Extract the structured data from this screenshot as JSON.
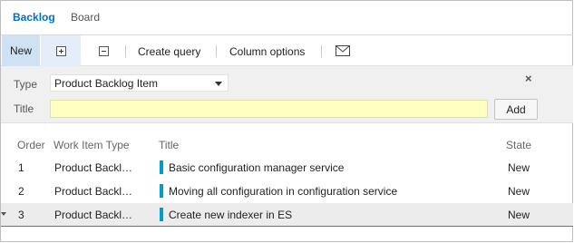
{
  "tabs": {
    "backlog": "Backlog",
    "board": "Board"
  },
  "toolbar": {
    "new_label": "New",
    "expand_icon": "expand-all-icon",
    "collapse_icon": "collapse-all-icon",
    "create_query": "Create query",
    "column_options": "Column options",
    "mail_icon": "mail-icon"
  },
  "add_panel": {
    "type_label": "Type",
    "type_value": "Product Backlog Item",
    "title_label": "Title",
    "title_value": "",
    "add_button": "Add",
    "close_glyph": "×"
  },
  "grid": {
    "columns": [
      "Order",
      "Work Item Type",
      "Title",
      "State"
    ],
    "rows": [
      {
        "order": "1",
        "type": "Product Backlog Item",
        "title": "Basic configuration manager service",
        "state": "New"
      },
      {
        "order": "2",
        "type": "Product Backlog Item",
        "title": "Moving all configuration in configuration service",
        "state": "New"
      },
      {
        "order": "3",
        "type": "Product Backlog Item",
        "title": "Create new indexer in ES",
        "state": "New"
      }
    ],
    "selected_row": 3
  },
  "colors": {
    "accent": "#0072c6",
    "toolbar_active": "#cfe2f3",
    "title_input": "#ffffc2",
    "work_item_bar": "#009ccc",
    "selection_line": "#3c9a3c"
  }
}
